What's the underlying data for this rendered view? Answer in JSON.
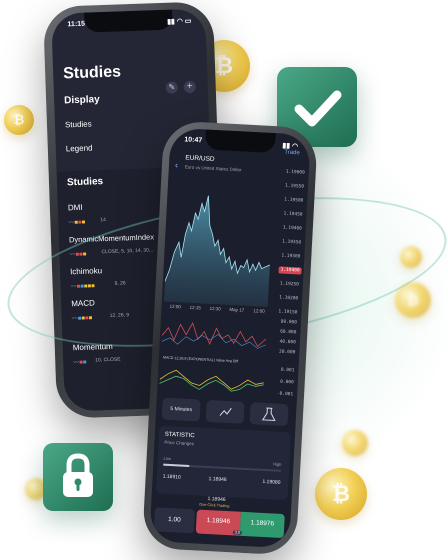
{
  "colors": {
    "accent_green": "#2f8a6b",
    "price_red": "#c94a55",
    "price_green": "#2f9a6e",
    "screen_bg": "#1b1e2c",
    "line_cyan": "#8fd6ea"
  },
  "back_phone": {
    "time": "11:15",
    "title": "Studies",
    "display_section": "Display",
    "display_items": [
      "Studies",
      "Legend"
    ],
    "studies_section": "Studies",
    "studies": [
      {
        "name": "DMI",
        "params": "14"
      },
      {
        "name": "DynamicMomentumIndex",
        "params": "CLOSE, 5, 10, 14, 30,.."
      },
      {
        "name": "Ichimoku",
        "params": "9, 26"
      },
      {
        "name": "MACD",
        "params": "12, 26, 9"
      },
      {
        "name": "Momentum",
        "params": "10, CLOSE"
      }
    ],
    "close_symbol": "✕"
  },
  "front_phone": {
    "time": "10:47",
    "symbol": "EUR/USD",
    "subtitle": "Euro vs United States Dollar",
    "trade_link": "Trade",
    "price_tag": "1.19400",
    "price_axis": [
      "1.19600",
      "1.19550",
      "1.19500",
      "1.19450",
      "1.19400",
      "1.19350",
      "1.19300",
      "1.19250",
      "1.19200",
      "1.19150"
    ],
    "time_axis": [
      "12:00",
      "12:15",
      "12:30",
      "May 17",
      "12:00"
    ],
    "osc_axis": [
      "80.000",
      "60.000",
      "40.000",
      "20.000"
    ],
    "macd_label": "MACD 12,26,9 (EXPONENTIAL)  Value  Avg  Diff",
    "macd_axis": [
      "0.001",
      "0.000",
      "-0.001"
    ],
    "timeframe": "5 Minutes",
    "statistic_title": "STATISTIC",
    "statistic_sub": "Price Changes",
    "low_label": "Low",
    "high_label": "High",
    "stat_values": [
      "1.18910",
      "1.18946",
      "1.19080"
    ],
    "stat_center_value": "1.18946",
    "one_click": "One Click Trading",
    "lot": "1.00",
    "sell_price": "1.18946",
    "buy_price": "1.18976",
    "spread": "3.0"
  }
}
